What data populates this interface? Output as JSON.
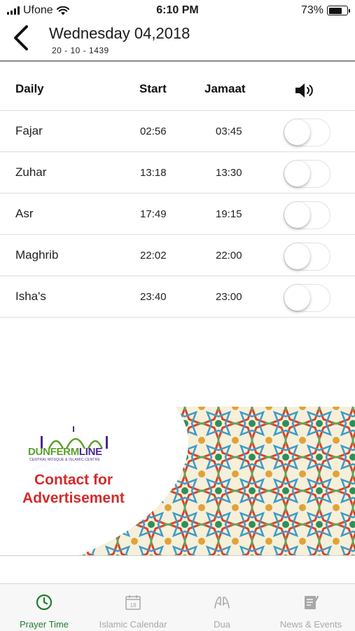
{
  "status_bar": {
    "carrier": "Ufone",
    "time": "6:10 PM",
    "battery": "73%",
    "battery_level": 0.73
  },
  "header": {
    "title": "Wednesday 04,2018",
    "hijri_date": "20 - 10 - 1439",
    "back_icon": "chevron-left-icon"
  },
  "table": {
    "columns": {
      "daily": "Daily",
      "start": "Start",
      "jamaat": "Jamaat",
      "sound_icon": "speaker-icon"
    },
    "rows": [
      {
        "name": "Fajar",
        "start": "02:56",
        "jamaat": "03:45",
        "alert_on": false
      },
      {
        "name": "Zuhar",
        "start": "13:18",
        "jamaat": "13:30",
        "alert_on": false
      },
      {
        "name": "Asr",
        "start": "17:49",
        "jamaat": "19:15",
        "alert_on": false
      },
      {
        "name": "Maghrib",
        "start": "22:02",
        "jamaat": "22:00",
        "alert_on": false
      },
      {
        "name": "Isha's",
        "start": "23:40",
        "jamaat": "23:00",
        "alert_on": false
      }
    ]
  },
  "ad": {
    "logo_name": "DUNFERMLINE",
    "logo_part_green": "DUNFERM",
    "logo_part_purple": "LINE",
    "logo_subtitle": "CENTRAL MOSQUE & ISLAMIC CENTRE",
    "headline_line1": "Contact for",
    "headline_line2": "Advertisement",
    "headline_color": "#d42a2a"
  },
  "tabbar": {
    "accent_color": "#1e7d2c",
    "tabs": [
      {
        "label": "Prayer Time",
        "icon": "clock-icon",
        "active": true
      },
      {
        "label": "Islamic Calendar",
        "icon": "calendar-icon",
        "active": false
      },
      {
        "label": "Dua",
        "icon": "praying-hands-icon",
        "active": false
      },
      {
        "label": "News & Events",
        "icon": "news-icon",
        "active": false
      }
    ],
    "calendar_day": "18"
  }
}
